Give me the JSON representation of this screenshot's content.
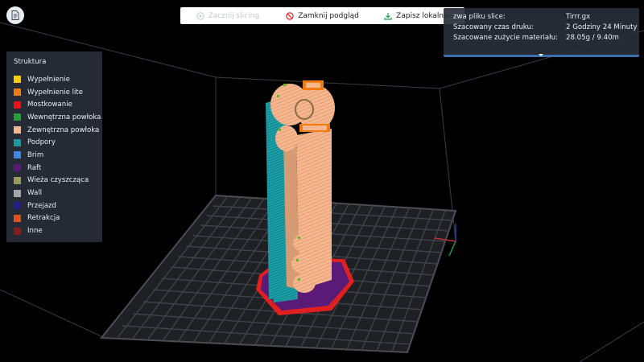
{
  "toolbar": {
    "start_slicing": "Zacznij slicing",
    "close_preview": "Zamknij podgląd",
    "save_local": "Zapisz lokalnie"
  },
  "info": {
    "file_label": "zwa pliku slice:",
    "file_value": "Tirrr.gx",
    "time_label": "Szacowany czas druku:",
    "time_value": "2 Godziny 24 Minuty",
    "material_label": "Szacowane zużycie materiału:",
    "material_value": "28.05g / 9.40m"
  },
  "legend": {
    "title": "Struktura",
    "items": [
      {
        "label": "Wypełnienie",
        "color": "#ffcc00"
      },
      {
        "label": "Wypełnienie lite",
        "color": "#f07c10"
      },
      {
        "label": "Mostkowanie",
        "color": "#ee1111"
      },
      {
        "label": "Wewnętrzna powłoka",
        "color": "#22a033"
      },
      {
        "label": "Zewnętrzna powłoka",
        "color": "#f7b68e"
      },
      {
        "label": "Podpory",
        "color": "#1a9aa0"
      },
      {
        "label": "Brim",
        "color": "#3d86e8"
      },
      {
        "label": "Raft",
        "color": "#5a1a78"
      },
      {
        "label": "Wieża czyszcząca",
        "color": "#9a9a5a"
      },
      {
        "label": "Wall",
        "color": "#a6a6a6"
      },
      {
        "label": "Przejazd",
        "color": "#1f1f8a"
      },
      {
        "label": "Retrakcja",
        "color": "#e0501a"
      },
      {
        "label": "Inne",
        "color": "#8a1c1c"
      }
    ]
  },
  "colors": {
    "background": "#000000",
    "panel": "#282e3a",
    "grid": "#3c3f45",
    "accent": "#3d6fb0"
  },
  "icons": {
    "file": "file-icon",
    "start": "play-circle-icon",
    "close": "prohibited-icon",
    "save": "download-icon"
  }
}
